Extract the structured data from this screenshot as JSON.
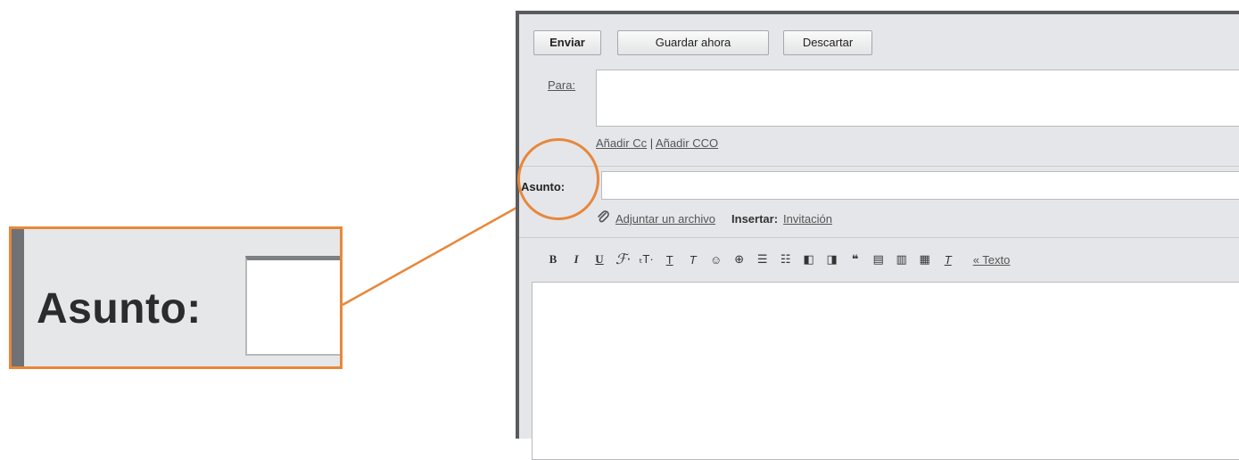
{
  "zoom": {
    "label": "Asunto:"
  },
  "toolbar": {
    "send_label": "Enviar",
    "save_label": "Guardar ahora",
    "discard_label": "Descartar"
  },
  "fields": {
    "to_label": "Para:",
    "add_cc": "Añadir Cc",
    "separator": "|",
    "add_bcc": "Añadir CCO",
    "subject_label": "Asunto:"
  },
  "attach": {
    "attach_label": "Adjuntar un archivo",
    "insert_label": "Insertar:",
    "invite_label": "Invitación"
  },
  "format": {
    "bold": "B",
    "italic": "I",
    "underline": "U",
    "font": "ℱ·",
    "size": "ₜT·",
    "text_color": "T",
    "highlight": "T",
    "emoji": "☺",
    "link": "⊕",
    "numbered_list": "☰",
    "bullet_list": "☷",
    "indent_less": "◧",
    "indent_more": "◨",
    "quote": "❝",
    "align_left": "▤",
    "align_center": "▥",
    "align_right": "▦",
    "remove_format": "T",
    "plain_text": "« Texto"
  },
  "colors": {
    "accent": "#e8873a",
    "panel": "#e4e6e9"
  }
}
